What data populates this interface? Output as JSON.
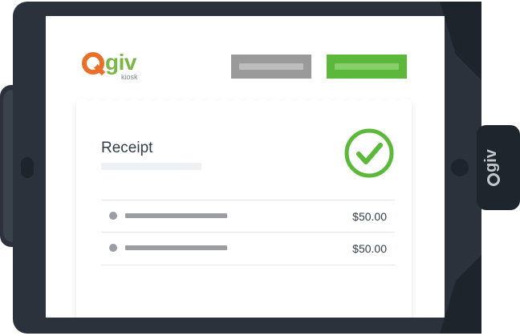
{
  "brand": {
    "logo_text": "giv",
    "logo_sub": "kiosk",
    "side_logo_text": "giv",
    "accent_green": "#5cb83b",
    "accent_orange": "#e8702a",
    "frame_color": "#2b323b"
  },
  "header": {
    "secondary_button": "",
    "primary_button": ""
  },
  "receipt": {
    "title": "Receipt",
    "status_icon": "check-circle-icon",
    "items": [
      {
        "amount": "$50.00"
      },
      {
        "amount": "$50.00"
      }
    ]
  }
}
